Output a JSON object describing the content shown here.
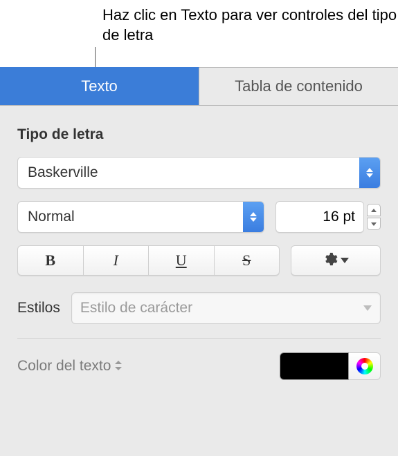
{
  "callout": "Haz clic en Texto para ver controles del tipo de letra",
  "tabs": {
    "text": "Texto",
    "toc": "Tabla de contenido"
  },
  "section": {
    "font_header": "Tipo de letra"
  },
  "font": {
    "family": "Baskerville",
    "weight": "Normal",
    "size": "16 pt"
  },
  "style_buttons": {
    "bold": "B",
    "italic": "I",
    "underline": "U",
    "strike": "S"
  },
  "styles": {
    "label": "Estilos",
    "placeholder": "Estilo de carácter"
  },
  "text_color": {
    "label": "Color del texto",
    "value": "#000000"
  }
}
